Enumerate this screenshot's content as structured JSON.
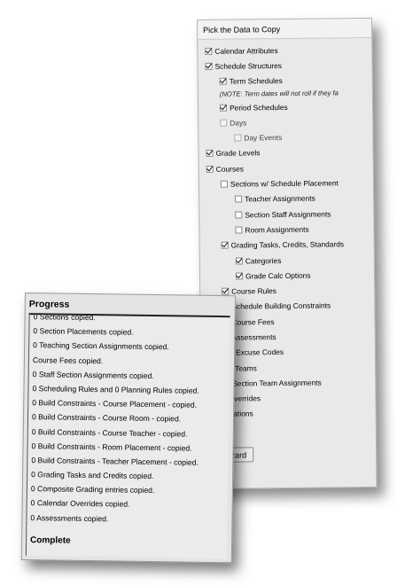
{
  "copy_panel": {
    "title": "Pick the Data to Copy",
    "items": [
      {
        "label": "Calendar Attributes",
        "checked": true,
        "indent": 0
      },
      {
        "label": "Schedule Structures",
        "checked": true,
        "indent": 0
      },
      {
        "label": "Term Schedules",
        "checked": true,
        "indent": 1
      },
      {
        "label": "(NOTE: Term dates will not roll if they fa",
        "note": true,
        "indent": 1
      },
      {
        "label": "Period Schedules",
        "checked": true,
        "indent": 1
      },
      {
        "label": "Days",
        "checked": false,
        "disabled": true,
        "indent": 1
      },
      {
        "label": "Day Events",
        "checked": false,
        "disabled": true,
        "indent": 2
      },
      {
        "label": "Grade Levels",
        "checked": true,
        "indent": 0
      },
      {
        "label": "Courses",
        "checked": true,
        "indent": 0
      },
      {
        "label": "Sections w/ Schedule Placement",
        "checked": false,
        "indent": 1
      },
      {
        "label": "Teacher Assignments",
        "checked": false,
        "indent": 2
      },
      {
        "label": "Section Staff Assignments",
        "checked": false,
        "indent": 2
      },
      {
        "label": "Room Assignments",
        "checked": false,
        "indent": 2
      },
      {
        "label": "Grading Tasks, Credits, Standards",
        "checked": true,
        "indent": 1
      },
      {
        "label": "Categories",
        "checked": true,
        "indent": 2
      },
      {
        "label": "Grade Calc Options",
        "checked": true,
        "indent": 2
      },
      {
        "label": "Course Rules",
        "checked": true,
        "indent": 1
      },
      {
        "label": "Schedule Building Constraints",
        "checked": true,
        "indent": 1
      },
      {
        "label": "Course Fees",
        "checked": true,
        "indent": 1
      },
      {
        "label": "Assessments",
        "checked": true,
        "indent": 1
      },
      {
        "label": "ttendance Excuse Codes",
        "checked": null,
        "indent": 0
      },
      {
        "label": "cheduling Teams",
        "checked": null,
        "indent": 0
      },
      {
        "label": "Section Team Assignments",
        "checked": false,
        "indent": 1
      },
      {
        "label": "alendar Overrides",
        "checked": null,
        "indent": 0
      },
      {
        "label": "PA Calculations",
        "checked": null,
        "indent": 0
      }
    ],
    "button_label": "n Wizard"
  },
  "progress": {
    "title": "Progress",
    "lines": [
      "0 Sections copied.",
      "0 Section Placements copied.",
      "0 Teaching Section Assignments copied.",
      "Course Fees copied.",
      "0 Staff Section Assignments copied.",
      "0 Scheduling Rules and 0 Planning Rules copied.",
      "0 Build Constraints - Course Placement - copied.",
      "0 Build Constraints - Course Room - copied.",
      "0 Build Constraints - Course Teacher - copied.",
      "0 Build Constraints - Room Placement - copied.",
      "0 Build Constraints - Teacher Placement - copied.",
      "0 Grading Tasks and Credits copied.",
      "0 Composite Grading entries copied.",
      "0 Calendar Overrides copied.",
      "0 Assessments copied."
    ],
    "status": "Complete"
  }
}
